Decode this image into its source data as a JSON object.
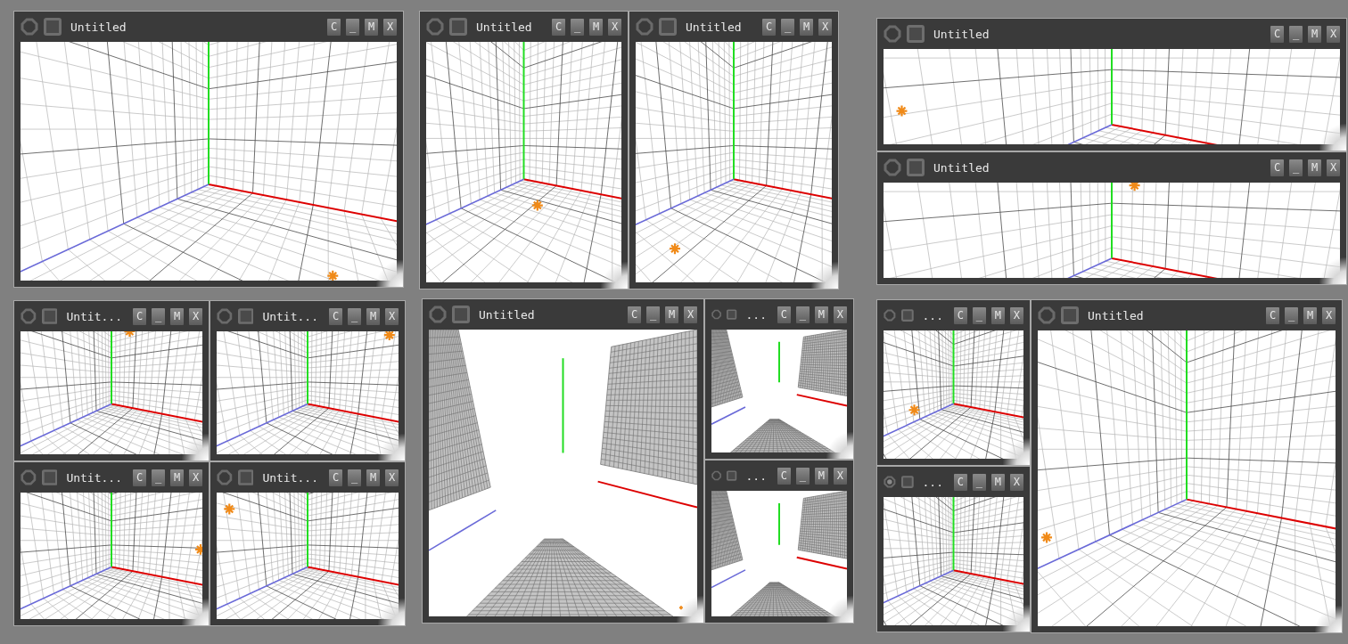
{
  "windows": [
    {
      "title": "Untitled",
      "active": false,
      "kind": "corner",
      "buttons": [
        "C",
        "_",
        "M",
        "X"
      ]
    },
    {
      "title": "Untitled",
      "active": false,
      "kind": "corner",
      "buttons": [
        "C",
        "_",
        "M",
        "X"
      ]
    },
    {
      "title": "Untitled",
      "active": false,
      "kind": "corner",
      "buttons": [
        "C",
        "_",
        "M",
        "X"
      ]
    },
    {
      "title": "Untitled",
      "active": false,
      "kind": "corner",
      "buttons": [
        "C",
        "_",
        "M",
        "X"
      ]
    },
    {
      "title": "Untitled",
      "active": false,
      "kind": "corner",
      "buttons": [
        "C",
        "_",
        "M",
        "X"
      ]
    },
    {
      "title": "Untit...",
      "active": false,
      "kind": "corner",
      "buttons": [
        "C",
        "_",
        "M",
        "X"
      ]
    },
    {
      "title": "Untit...",
      "active": false,
      "kind": "corner",
      "buttons": [
        "C",
        "_",
        "M",
        "X"
      ]
    },
    {
      "title": "Untit...",
      "active": false,
      "kind": "corner",
      "buttons": [
        "C",
        "_",
        "M",
        "X"
      ]
    },
    {
      "title": "Untit...",
      "active": false,
      "kind": "corner",
      "buttons": [
        "C",
        "_",
        "M",
        "X"
      ]
    },
    {
      "title": "Untitled",
      "active": false,
      "kind": "panels",
      "buttons": [
        "C",
        "_",
        "M",
        "X"
      ]
    },
    {
      "title": "...",
      "active": false,
      "kind": "panels",
      "buttons": [
        "C",
        "_",
        "M",
        "X"
      ]
    },
    {
      "title": "...",
      "active": false,
      "kind": "panels",
      "buttons": [
        "C",
        "_",
        "M",
        "X"
      ]
    },
    {
      "title": "...",
      "active": false,
      "kind": "corner",
      "buttons": [
        "C",
        "_",
        "M",
        "X"
      ]
    },
    {
      "title": "...",
      "active": true,
      "kind": "corner",
      "buttons": [
        "C",
        "_",
        "M",
        "X"
      ]
    },
    {
      "title": "Untitled",
      "active": false,
      "kind": "corner",
      "buttons": [
        "C",
        "_",
        "M",
        "X"
      ]
    }
  ]
}
